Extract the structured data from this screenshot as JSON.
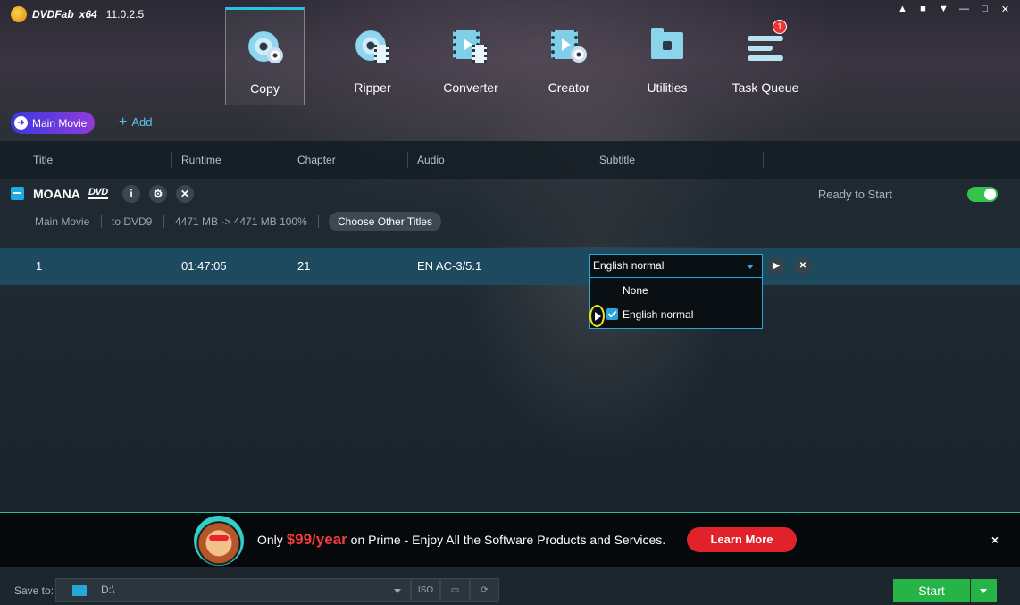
{
  "app": {
    "brand": "DVDFab",
    "arch": "x64",
    "version": "11.0.2.5"
  },
  "window_controls": [
    "pin-icon",
    "skin-icon",
    "menu-icon",
    "minimize-icon",
    "maximize-icon",
    "close-icon"
  ],
  "modules": [
    {
      "label": "Copy",
      "icon": "copy-disc-icon",
      "active": true
    },
    {
      "label": "Ripper",
      "icon": "ripper-icon",
      "active": false
    },
    {
      "label": "Converter",
      "icon": "converter-icon",
      "active": false
    },
    {
      "label": "Creator",
      "icon": "creator-icon",
      "active": false
    },
    {
      "label": "Utilities",
      "icon": "utilities-icon",
      "active": false
    },
    {
      "label": "Task Queue",
      "icon": "task-queue-icon",
      "active": false,
      "badge": "1"
    }
  ],
  "mode_button": "Main Movie",
  "add_button": "Add",
  "columns": [
    "Title",
    "Runtime",
    "Chapter",
    "Audio",
    "Subtitle"
  ],
  "movie": {
    "title": "MOANA",
    "disc_type": "DVD",
    "status": "Ready to Start",
    "toggle_on": true,
    "mode": "Main Movie",
    "target": "to DVD9",
    "size": "4471 MB -> 4471 MB 100%",
    "choose_other": "Choose Other Titles"
  },
  "title_row": {
    "title": "1",
    "runtime": "01:47:05",
    "chapter": "21",
    "audio": "EN  AC-3/5.1",
    "subtitle_selected": "English normal",
    "subtitle_options": [
      {
        "label": "None",
        "checked": false
      },
      {
        "label": "English normal",
        "checked": true
      }
    ]
  },
  "promo": {
    "prefix": "Only ",
    "price": "$99/year",
    "suffix": " on Prime - Enjoy All the Software Products and Services.",
    "cta": "Learn More",
    "close": "×"
  },
  "bottom": {
    "save_to_label": "Save to:",
    "path": "D:\\",
    "start": "Start"
  },
  "colors": {
    "accent": "#27a6dc",
    "start_green": "#27b446",
    "promo_red": "#e1222a",
    "toggle_green": "#35c44b"
  }
}
